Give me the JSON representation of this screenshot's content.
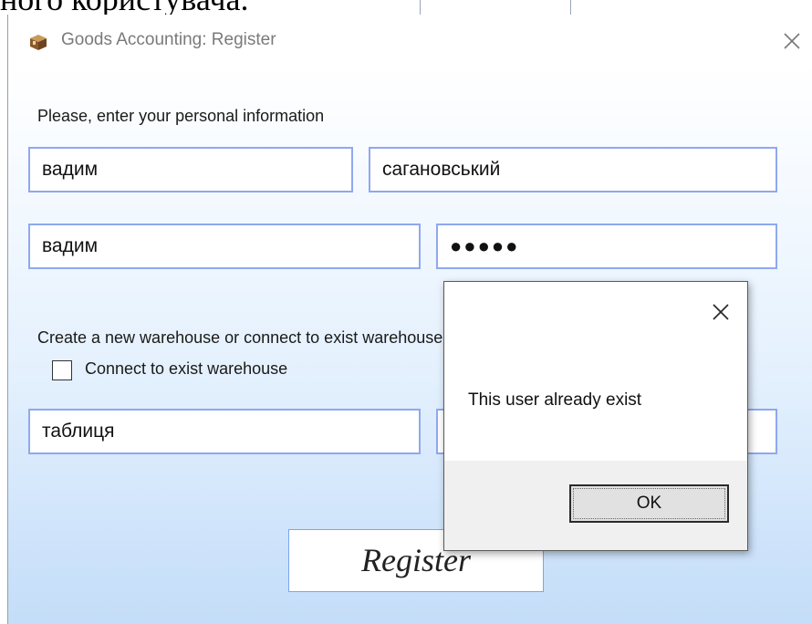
{
  "background_doc": {
    "text": "ного користувача."
  },
  "window": {
    "title": "Goods Accounting: Register",
    "icon": "box-icon",
    "prompt": "Please, enter your personal information",
    "first_name": "вадим",
    "last_name": "сагановський",
    "login": "вадим",
    "password_mask": "●●●●●",
    "warehouse_prompt": "Create a new warehouse or connect to exist warehouse",
    "connect_checkbox": {
      "label": "Connect to exist warehouse",
      "checked": false
    },
    "warehouse_name": "таблиця",
    "warehouse_second": "",
    "register_label": "Register",
    "colors": {
      "field_border": "#8fa8f0",
      "gradient_bottom": "#c4ddf8"
    }
  },
  "message_box": {
    "message": "This user already exist",
    "ok_label": "OK",
    "close_icon": "close-icon"
  }
}
